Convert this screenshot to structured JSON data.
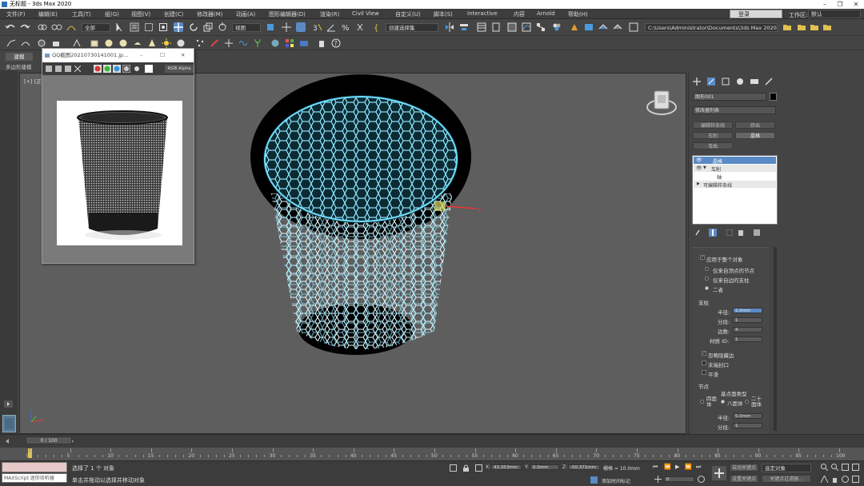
{
  "app": {
    "title": "无标题 - 3ds Max 2020",
    "login": "登录",
    "workspace_label": "工作区:",
    "workspace_value": "默认"
  },
  "menu": [
    "文件(F)",
    "编辑(E)",
    "工具(T)",
    "组(G)",
    "视图(V)",
    "创建(C)",
    "修改器(M)",
    "动画(A)",
    "图形编辑器(D)",
    "渲染(R)",
    "Civil View",
    "自定义(U)",
    "脚本(S)",
    "Interactive",
    "内容",
    "Arnold",
    "帮助(H)"
  ],
  "toolbar": {
    "selection_filter": "全部",
    "ref_coord": "视图",
    "named_selection": "创建选择集",
    "project_path": "C:\\Users\\Administrator\\Documents\\3ds Max 2020"
  },
  "ribbon": {
    "tab": "建模",
    "sub": "多边形建模"
  },
  "viewport": {
    "label": "[+] [正",
    "gizmo_axis": "x"
  },
  "image_viewer": {
    "title": "QQ截图20210730141001.jp...",
    "channel": "RGB Alpha"
  },
  "command_panel": {
    "object_name": "图形001",
    "modifier_list": "修改器列表",
    "buttons": [
      "编辑样条线",
      "挤出",
      "车削",
      "晶格",
      "弯曲"
    ],
    "stack": [
      "晶格",
      "车削",
      "轴",
      "可编辑样条线"
    ],
    "params": {
      "apply_whole": "应用于整个对象",
      "only_vertices": "仅来自顶点的节点",
      "only_edges": "仅来自边的支柱",
      "both": "二者",
      "struts_title": "支柱",
      "radius_label": "半径:",
      "radius_value": "1.0mm",
      "segments_label": "分段:",
      "segments_value": "1",
      "sides_label": "边数:",
      "sides_value": "4",
      "matid_label": "材质 ID:",
      "matid_value": "1",
      "ignore_hidden": "忽略隐藏边",
      "end_caps": "末端封口",
      "smooth": "平滑",
      "joints_title": "节点",
      "geo_type": "基点面类型",
      "tetra": "四面体",
      "octa": "八面体",
      "icosa": "二十面体",
      "j_radius_label": "半径:",
      "j_radius_value": "5.0mm",
      "j_seg_label": "分段:",
      "j_seg_value": "1"
    }
  },
  "timeline": {
    "slider": "0 / 100",
    "ticks": [
      "0",
      "5",
      "10",
      "15",
      "20",
      "25",
      "30",
      "35",
      "40",
      "45",
      "50",
      "55",
      "60",
      "65",
      "70",
      "75",
      "80",
      "85",
      "90",
      "95",
      "100"
    ]
  },
  "status": {
    "maxscript": "MAXScript 迷你侦听器",
    "selected": "选择了 1 个 对象",
    "hint": "单击并拖动以选择并移动对象",
    "x_label": "X:",
    "x_value": "43.353mm",
    "y_label": "Y:",
    "y_value": "0.0mm",
    "z_label": "Z:",
    "z_value": "-50.371mm",
    "grid": "栅格 = 10.0mm",
    "add_time_tag": "添加时间标记",
    "auto_key": "自动关键点",
    "set_key": "设置关键点",
    "selected_obj": "选定对象",
    "key_filters": "关键点过滤器...",
    "frame": "0"
  }
}
